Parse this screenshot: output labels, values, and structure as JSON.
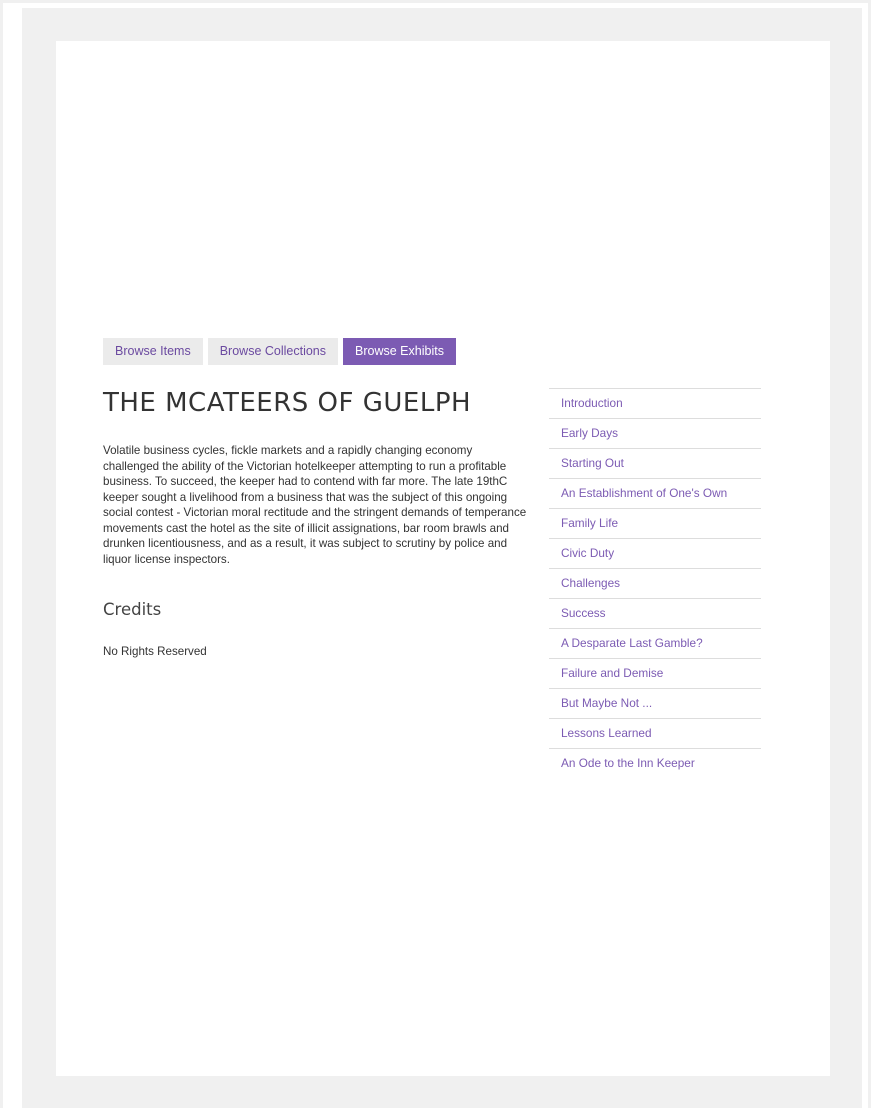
{
  "nav": {
    "tabs": [
      {
        "label": "Browse Items",
        "active": false
      },
      {
        "label": "Browse Collections",
        "active": false
      },
      {
        "label": "Browse Exhibits",
        "active": true
      }
    ]
  },
  "exhibit": {
    "title": "THE MCATEERS OF GUELPH",
    "description": "Volatile business cycles, fickle markets and a rapidly changing economy challenged the ability of the Victorian hotelkeeper attempting to run a profitable business. To succeed, the keeper had to contend with far more. The late 19thC keeper sought a livelihood from a business that was the subject of this ongoing social contest - Victorian moral rectitude and the stringent demands of temperance movements cast the hotel as the site of illicit assignations, bar room brawls and drunken licentiousness, and as a result, it was subject to scrutiny by police and liquor license inspectors.",
    "credits_heading": "Credits",
    "credits_text": "No Rights Reserved"
  },
  "toc": {
    "items": [
      "Introduction",
      "Early Days",
      "Starting Out",
      "An Establishment of One's Own",
      "Family Life",
      "Civic Duty",
      "Challenges",
      "Success",
      "A Desparate Last Gamble?",
      "Failure and Demise",
      "But Maybe Not ...",
      "Lessons Learned",
      "An Ode to the Inn Keeper"
    ]
  },
  "colors": {
    "accent": "#7c5bb3",
    "tab_background": "#ebebeb",
    "page_background": "#f0f0f0"
  }
}
